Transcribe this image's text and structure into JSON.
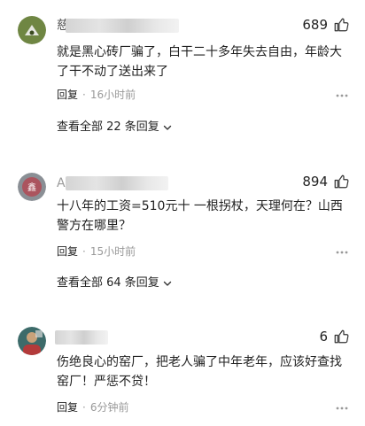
{
  "comments": [
    {
      "username_visible": "慈",
      "likes": "689",
      "text": "就是黑心砖厂骗了，白干二十多年失去自由，年龄大了干不动了送出来了",
      "reply_label": "回复",
      "time": "16小时前",
      "view_all": "查看全部 22 条回复"
    },
    {
      "username_visible": "A",
      "likes": "894",
      "text": "十八年的工资=510元十 一根拐杖，天理何在？山西警方在哪里？",
      "reply_label": "回复",
      "time": "15小时前",
      "view_all": "查看全部 64 条回复"
    },
    {
      "username_visible": "",
      "likes": "6",
      "text": "伤绝良心的窑厂，把老人骗了中年老年，应该好查找窑厂！严惩不贷！",
      "reply_label": "回复",
      "time": "6分钟前"
    }
  ],
  "colors": {
    "text": "#222222",
    "meta": "#999999",
    "avatar1": "#7b8e4a",
    "avatar2": "#8a8f95",
    "avatar3": "#3d6b6a"
  },
  "icons": {
    "like": "thumbs-up-icon",
    "more": "more-dots-icon",
    "expand": "chevron-down-icon"
  }
}
